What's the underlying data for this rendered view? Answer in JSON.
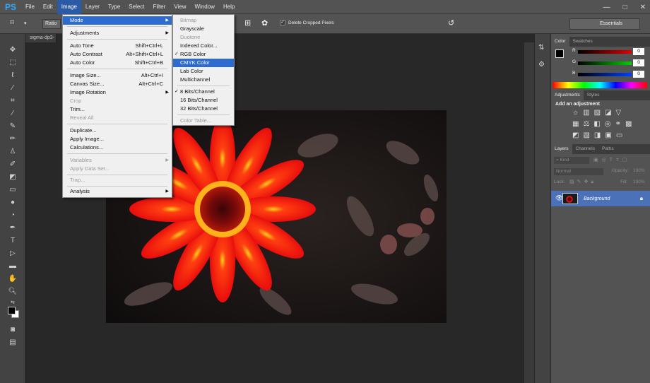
{
  "app": {
    "logo": "PS"
  },
  "menubar": {
    "items": [
      "File",
      "Edit",
      "Image",
      "Layer",
      "Type",
      "Select",
      "Filter",
      "View",
      "Window",
      "Help"
    ],
    "window_controls": [
      "—",
      "□",
      "✕"
    ]
  },
  "options": {
    "ratio_label": "Ratio",
    "delete_cropped_label": "Delete Cropped Pixels",
    "delete_cropped_checked": "✓",
    "workspace": "Essentials"
  },
  "document": {
    "tab": "sigma-dp3-"
  },
  "image_menu": {
    "items": [
      {
        "label": "Mode",
        "shortcut": "",
        "submenu": "▶",
        "state": "highlighted"
      },
      {
        "label": "Adjustments",
        "shortcut": "",
        "submenu": "▶",
        "state": "normal"
      },
      {
        "label": "Auto Tone",
        "shortcut": "Shift+Ctrl+L",
        "submenu": "",
        "state": "normal"
      },
      {
        "label": "Auto Contrast",
        "shortcut": "Alt+Shift+Ctrl+L",
        "submenu": "",
        "state": "normal"
      },
      {
        "label": "Auto Color",
        "shortcut": "Shift+Ctrl+B",
        "submenu": "",
        "state": "normal"
      },
      {
        "label": "Image Size...",
        "shortcut": "Alt+Ctrl+I",
        "submenu": "",
        "state": "normal"
      },
      {
        "label": "Canvas Size...",
        "shortcut": "Alt+Ctrl+C",
        "submenu": "",
        "state": "normal"
      },
      {
        "label": "Image Rotation",
        "shortcut": "",
        "submenu": "▶",
        "state": "normal"
      },
      {
        "label": "Crop",
        "shortcut": "",
        "submenu": "",
        "state": "disabled"
      },
      {
        "label": "Trim...",
        "shortcut": "",
        "submenu": "",
        "state": "normal"
      },
      {
        "label": "Reveal All",
        "shortcut": "",
        "submenu": "",
        "state": "disabled"
      },
      {
        "label": "Duplicate...",
        "shortcut": "",
        "submenu": "",
        "state": "normal"
      },
      {
        "label": "Apply Image...",
        "shortcut": "",
        "submenu": "",
        "state": "normal"
      },
      {
        "label": "Calculations...",
        "shortcut": "",
        "submenu": "",
        "state": "normal"
      },
      {
        "label": "Variables",
        "shortcut": "",
        "submenu": "▶",
        "state": "disabled"
      },
      {
        "label": "Apply Data Set...",
        "shortcut": "",
        "submenu": "",
        "state": "disabled"
      },
      {
        "label": "Trap...",
        "shortcut": "",
        "submenu": "",
        "state": "disabled"
      },
      {
        "label": "Analysis",
        "shortcut": "",
        "submenu": "▶",
        "state": "normal"
      }
    ]
  },
  "mode_menu": {
    "items": [
      {
        "label": "Bitmap",
        "check": "",
        "state": "disabled"
      },
      {
        "label": "Grayscale",
        "check": "",
        "state": "normal"
      },
      {
        "label": "Duotone",
        "check": "",
        "state": "disabled"
      },
      {
        "label": "Indexed Color...",
        "check": "",
        "state": "normal"
      },
      {
        "label": "RGB Color",
        "check": "✓",
        "state": "normal"
      },
      {
        "label": "CMYK Color",
        "check": "",
        "state": "highlighted"
      },
      {
        "label": "Lab Color",
        "check": "",
        "state": "normal"
      },
      {
        "label": "Multichannel",
        "check": "",
        "state": "normal"
      },
      {
        "label": "8 Bits/Channel",
        "check": "✓",
        "state": "normal"
      },
      {
        "label": "16 Bits/Channel",
        "check": "",
        "state": "normal"
      },
      {
        "label": "32 Bits/Channel",
        "check": "",
        "state": "normal"
      },
      {
        "label": "Color Table...",
        "check": "",
        "state": "disabled"
      }
    ]
  },
  "color_panel": {
    "tabs": [
      "Color",
      "Swatches"
    ],
    "channels": [
      {
        "label": "R",
        "value": "0",
        "gradient": "#cc0000"
      },
      {
        "label": "G",
        "value": "0",
        "gradient": "#00b000"
      },
      {
        "label": "B",
        "value": "0",
        "gradient": "#0030e0"
      }
    ]
  },
  "adjustments_panel": {
    "tabs": [
      "Adjustments",
      "Styles"
    ],
    "title": "Add an adjustment"
  },
  "layers_panel": {
    "tabs": [
      "Layers",
      "Channels",
      "Paths"
    ],
    "kind_label": "Kind",
    "blend_mode": "Normal",
    "opacity_label": "Opacity:",
    "opacity_value": "100%",
    "lock_label": "Lock:",
    "fill_label": "Fill:",
    "fill_value": "100%",
    "layer_name": "Background"
  },
  "colors": {
    "accent": "#2e6bd0",
    "panel_bg": "#535353",
    "canvas_bg": "#282828"
  }
}
